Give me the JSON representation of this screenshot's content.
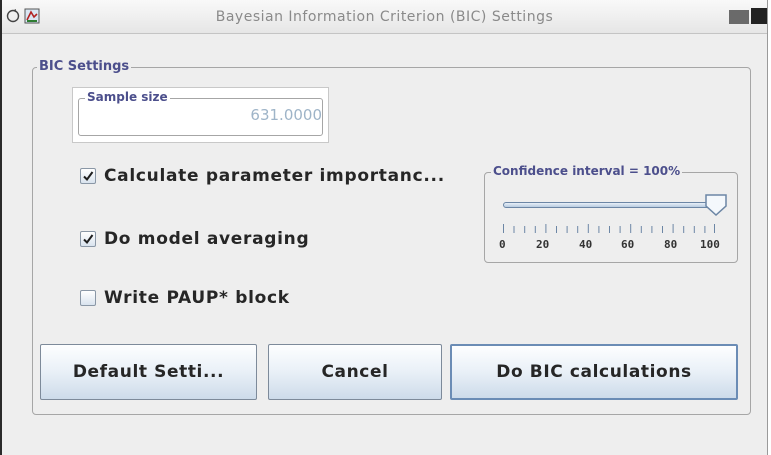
{
  "window": {
    "title": "Bayesian Information Criterion (BIC) Settings",
    "left_icon": "circle-arrow-icon",
    "app_icon": "app-icon"
  },
  "bic_settings": {
    "legend": "BIC Settings",
    "sample_size": {
      "legend": "Sample size",
      "value": "631.0000"
    },
    "checkboxes": [
      {
        "label": "Calculate parameter importanc...",
        "checked": true
      },
      {
        "label": "Do model averaging",
        "checked": true
      },
      {
        "label": "Write PAUP* block",
        "checked": false
      }
    ],
    "confidence": {
      "legend": "Confidence interval = 100%",
      "value_percent": 100,
      "tick_labels": [
        "0",
        "20",
        "40",
        "60",
        "80",
        "100"
      ]
    }
  },
  "buttons": {
    "default_settings": "Default Setti...",
    "cancel": "Cancel",
    "do_bic": "Do BIC calculations"
  },
  "colors": {
    "accent_label": "#4c4f8c",
    "field_text": "#9eb4c8"
  }
}
